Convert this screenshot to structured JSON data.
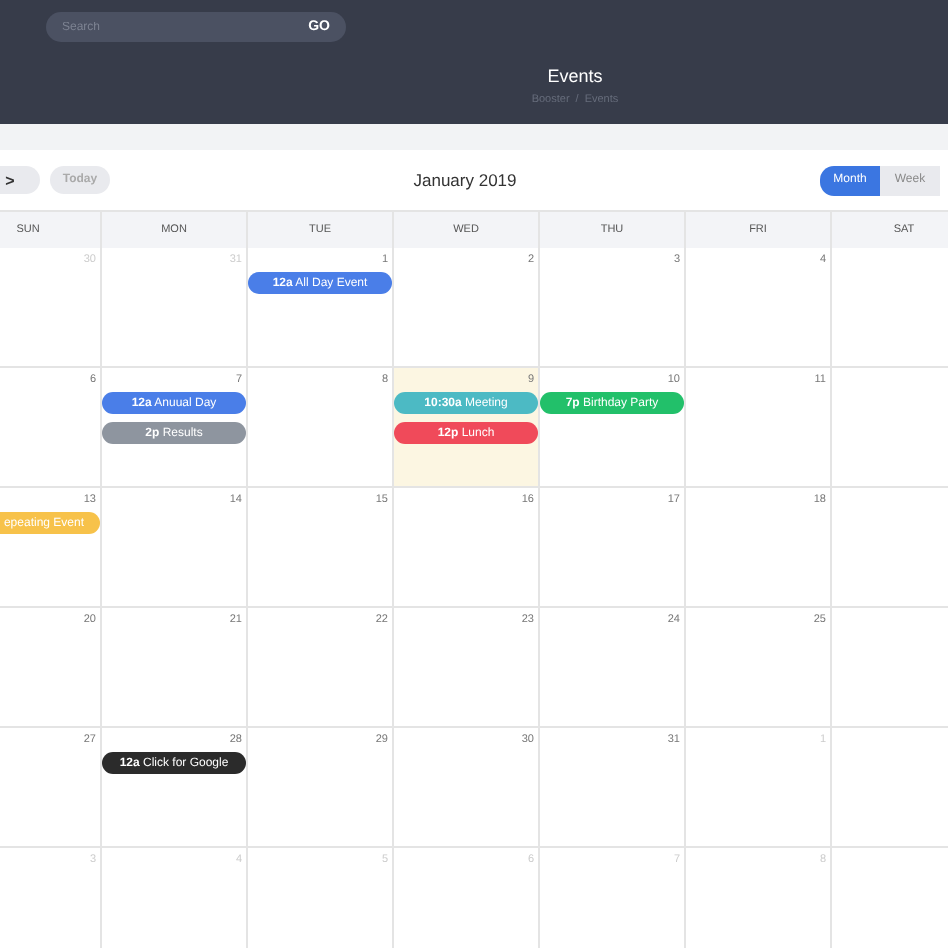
{
  "header": {
    "search": {
      "placeholder": "Search",
      "button": "GO"
    },
    "title": "Events",
    "breadcrumb": {
      "items": [
        "Booster",
        "Events"
      ],
      "separator": "/"
    }
  },
  "toolbar": {
    "next": ">",
    "today": "Today",
    "title": "January 2019",
    "views": [
      {
        "label": "Month",
        "selected": true
      },
      {
        "label": "Week",
        "selected": false
      }
    ]
  },
  "weekdays": [
    "SUN",
    "MON",
    "TUE",
    "WED",
    "THU",
    "FRI",
    "SAT"
  ],
  "weeks": [
    {
      "days": [
        {
          "number": "30",
          "muted": true
        },
        {
          "number": "31",
          "muted": true
        },
        {
          "number": "1",
          "events": [
            {
              "text": "**12a** All Day Event",
              "color": "#4a7ee8"
            }
          ]
        },
        {
          "number": "2"
        },
        {
          "number": "3"
        },
        {
          "number": "4"
        }
      ]
    },
    {
      "days": [
        {
          "number": "6"
        },
        {
          "number": "7",
          "events": [
            {
              "text": "**12a** Anuual Day",
              "color": "#4a7ee8"
            },
            {
              "text": "**2p** Results",
              "color": "#8e959f"
            }
          ]
        },
        {
          "number": "8"
        },
        {
          "number": "9",
          "today": true,
          "events": [
            {
              "text": "**10:30a** Meeting",
              "color": "#4cbac4"
            },
            {
              "text": "**12p** Lunch",
              "color": "#f04a5a"
            }
          ]
        },
        {
          "number": "10",
          "events": [
            {
              "text": "**7p** Birthday Party",
              "color": "#22c06a"
            }
          ]
        },
        {
          "number": "11"
        }
      ]
    },
    {
      "days": [
        {
          "number": "13",
          "events": [
            {
              "text": "epeating Event",
              "color": "#f7c24a",
              "clipped": true
            }
          ]
        },
        {
          "number": "14"
        },
        {
          "number": "15"
        },
        {
          "number": "16"
        },
        {
          "number": "17"
        },
        {
          "number": "18"
        }
      ]
    },
    {
      "days": [
        {
          "number": "20"
        },
        {
          "number": "21"
        },
        {
          "number": "22"
        },
        {
          "number": "23"
        },
        {
          "number": "24"
        },
        {
          "number": "25"
        }
      ]
    },
    {
      "days": [
        {
          "number": "27"
        },
        {
          "number": "28",
          "events": [
            {
              "text": "**12a** Click for Google",
              "color": "#2b2b2b"
            }
          ]
        },
        {
          "number": "29"
        },
        {
          "number": "30"
        },
        {
          "number": "31"
        },
        {
          "number": "1",
          "muted": true
        }
      ]
    },
    {
      "days": [
        {
          "number": "3",
          "muted": true
        },
        {
          "number": "4",
          "muted": true
        },
        {
          "number": "5",
          "muted": true
        },
        {
          "number": "6",
          "muted": true
        },
        {
          "number": "7",
          "muted": true
        },
        {
          "number": "8",
          "muted": true
        }
      ]
    }
  ]
}
